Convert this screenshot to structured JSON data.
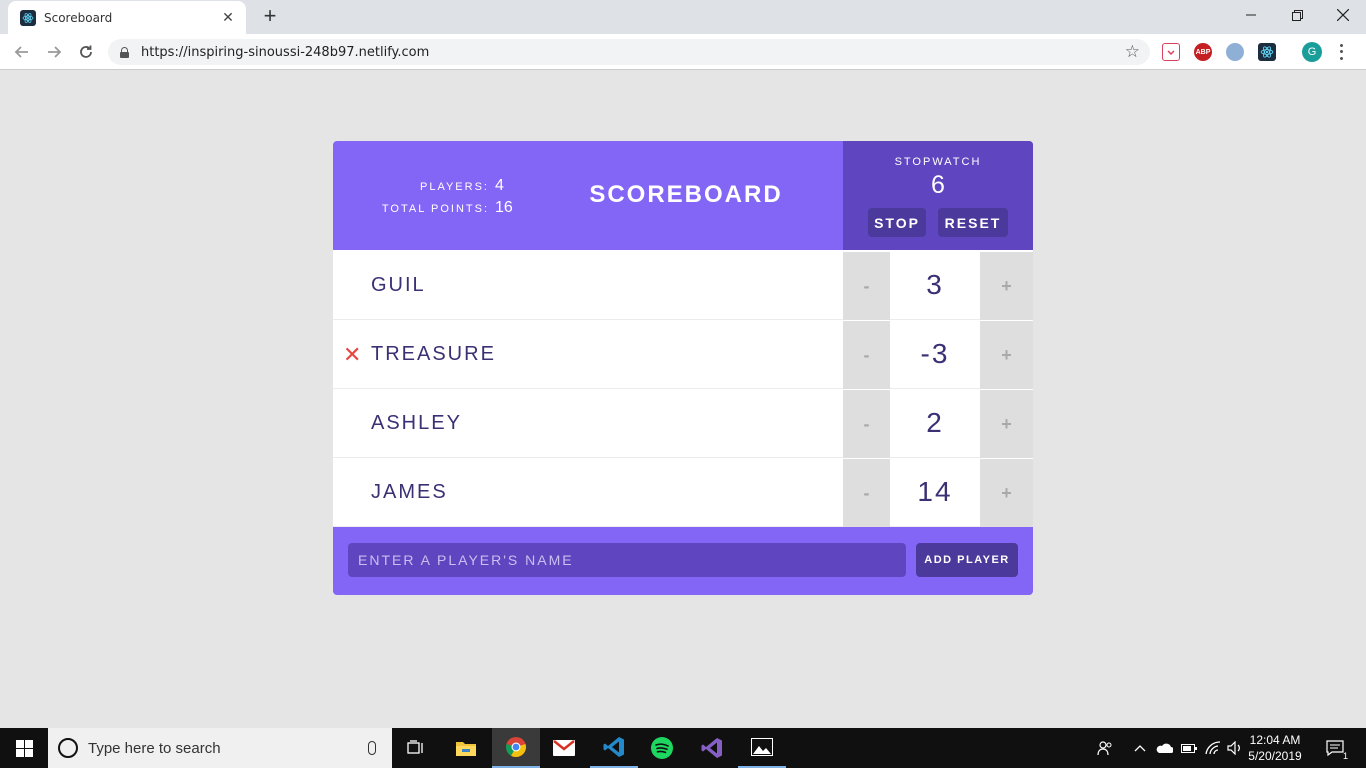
{
  "browser": {
    "tab_title": "Scoreboard",
    "tab_close": "✕",
    "new_tab": "+",
    "url": "https://inspiring-sinoussi-248b97.netlify.com",
    "extensions": [
      {
        "name": "pocket-icon",
        "color": "#d9415c"
      },
      {
        "name": "adblock-plus-icon",
        "label": "ABP",
        "color": "#c41f22"
      },
      {
        "name": "extension-icon",
        "color": "#6a8fb5"
      },
      {
        "name": "react-devtools-icon",
        "color": "#1b2d3e"
      }
    ],
    "profile_initial": "G"
  },
  "scoreboard": {
    "title": "SCOREBOARD",
    "stats": {
      "players_label": "PLAYERS:",
      "players_value": "4",
      "points_label": "TOTAL POINTS:",
      "points_value": "16"
    },
    "stopwatch": {
      "label": "STOPWATCH",
      "time": "6",
      "stop_label": "STOP",
      "reset_label": "RESET"
    },
    "players": [
      {
        "name": "GUIL",
        "score": "3",
        "show_remove": false
      },
      {
        "name": "TREASURE",
        "score": "-3",
        "show_remove": true
      },
      {
        "name": "ASHLEY",
        "score": "2",
        "show_remove": false
      },
      {
        "name": "JAMES",
        "score": "14",
        "show_remove": false
      }
    ],
    "decrement_label": "-",
    "increment_label": "+",
    "remove_label": "✕",
    "form": {
      "placeholder": "ENTER A PLAYER'S NAME",
      "add_label": "ADD PLAYER"
    },
    "colors": {
      "header": "#8466f7",
      "stopwatch": "#5f46c0",
      "button": "#4b3a9c",
      "remove": "#e8473e",
      "text": "#3b3074"
    }
  },
  "taskbar": {
    "search_placeholder": "Type here to search",
    "time": "12:04 AM",
    "date": "5/20/2019",
    "notification_count": "1"
  }
}
